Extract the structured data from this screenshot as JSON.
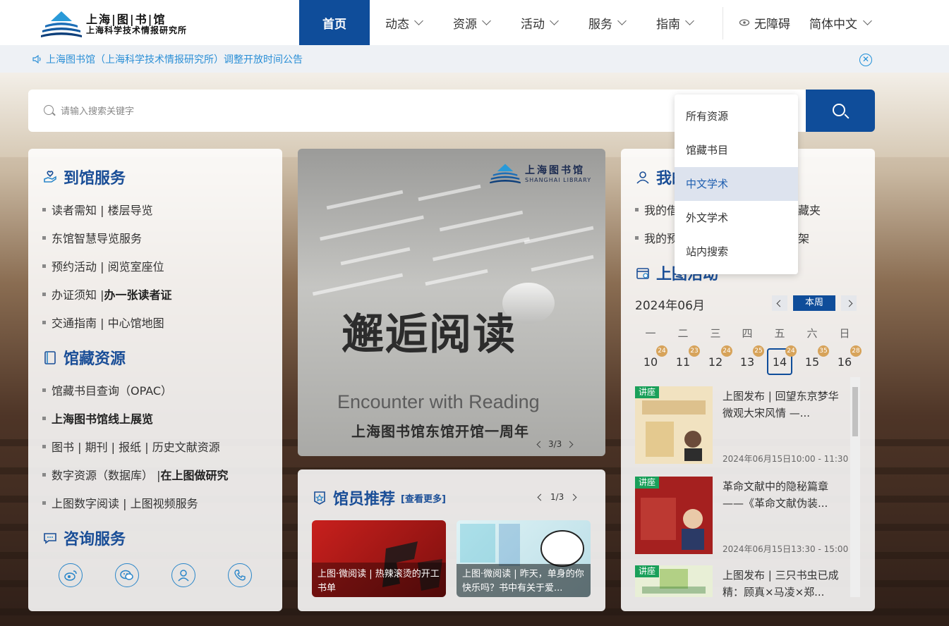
{
  "header": {
    "logo_cn": "上海|图|书|馆",
    "logo_sub": "上海科学技术情报研究所",
    "nav": [
      {
        "label": "首页"
      },
      {
        "label": "动态"
      },
      {
        "label": "资源"
      },
      {
        "label": "活动"
      },
      {
        "label": "服务"
      },
      {
        "label": "指南"
      }
    ],
    "accessibility": "无障碍",
    "language": "简体中文"
  },
  "notice": {
    "text": "上海图书馆（上海科学技术情报研究所）调整开放时间公告"
  },
  "search": {
    "placeholder": "请输入搜索关键字",
    "value": "",
    "scope_options": [
      "所有资源",
      "馆藏书目",
      "中文学术",
      "外文学术",
      "站内搜索"
    ],
    "hovered_option": "中文学术"
  },
  "left_panel": {
    "visit_title": "到馆服务",
    "visit_items": [
      {
        "a": "读者需知 | 楼层导览",
        "b": ""
      },
      {
        "a": "东馆智慧导览服务",
        "b": ""
      },
      {
        "a": "预约活动 | 阅览室座位",
        "b": ""
      },
      {
        "a": "办证须知 | ",
        "b": "办一张读者证"
      },
      {
        "a": "交通指南 | 中心馆地图",
        "b": ""
      }
    ],
    "collection_title": "馆藏资源",
    "collection_items": [
      {
        "a": "馆藏书目查询（OPAC）",
        "b": ""
      },
      {
        "a": "",
        "b": "上海图书馆线上展览"
      },
      {
        "a": "图书 | 期刊 | 报纸 | 历史文献资源",
        "b": ""
      },
      {
        "a": "数字资源（数据库） | ",
        "b": "在上图做研究"
      },
      {
        "a": "上图数字阅读 | 上图视频服务",
        "b": ""
      }
    ],
    "consult_title": "咨询服务",
    "consult_icons": [
      "weibo-icon",
      "wechat-icon",
      "service-agent-icon",
      "phone-icon"
    ]
  },
  "banner": {
    "logo": "上海图书馆",
    "logo_en": "SHANGHAI LIBRARY",
    "title": "邂逅阅读",
    "subtitle_en": "Encounter with Reading",
    "subtitle_cn": "上海图书馆东馆开馆一周年",
    "pager": "3/3"
  },
  "recommend": {
    "title": "馆员推荐",
    "more": "[查看更多]",
    "pager": "1/3",
    "cards": [
      {
        "caption": "上图·微阅读 | 热辣滚烫的开工书单"
      },
      {
        "caption": "上图·微阅读 | 昨天，单身的你快乐吗？书中有关于爱..."
      }
    ]
  },
  "right_panel": {
    "my_title": "我的",
    "my_items": [
      {
        "a": "我的借",
        "b": "藏夹"
      },
      {
        "a": "我的预",
        "b": "架"
      }
    ],
    "events_title": "上图活动",
    "calendar": {
      "month": "2024年06月",
      "this_week": "本周",
      "weekdays": [
        "一",
        "二",
        "三",
        "四",
        "五",
        "六",
        "日"
      ],
      "days": [
        "10",
        "11",
        "12",
        "13",
        "14",
        "15",
        "16"
      ],
      "counts": [
        "24",
        "23",
        "24",
        "25",
        "24",
        "35",
        "28"
      ],
      "today_index": 4
    },
    "events": [
      {
        "tag": "讲座",
        "title": "上图发布 | 回望东京梦华 微观大宋风情 —...",
        "time": "2024年06月15日10:00 - 11:30"
      },
      {
        "tag": "讲座",
        "title": "革命文献中的隐秘篇章——《革命文献伪装...",
        "time": "2024年06月15日13:30 - 15:00"
      },
      {
        "tag": "讲座",
        "title": "上图发布 | 三只书虫已成精：顾真×马凌×郑...",
        "time": ""
      }
    ]
  },
  "colors": {
    "primary": "#0f4d9a",
    "notice_text": "#2b8fd6",
    "tag_green": "#1aa05a",
    "badge": "#d7a35a"
  }
}
